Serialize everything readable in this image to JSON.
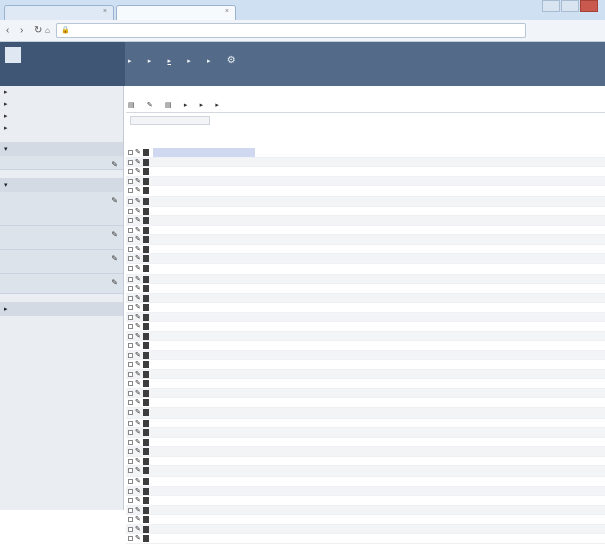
{
  "browser": {
    "tab1_label": "",
    "tab2_label": "",
    "url": ""
  },
  "logo": {
    "mark": "",
    "text_line1": "",
    "text_line2": "",
    "date": ""
  },
  "topnav": {
    "items": []
  },
  "sidebar": {
    "items": [],
    "sections": [],
    "groups": [],
    "links": []
  },
  "main": {
    "title": "",
    "toolbar": [],
    "filter_placeholder": "",
    "columns": [
      "",
      "",
      ""
    ],
    "rows": [
      {
        "c1": "",
        "c2": "",
        "c3": ""
      },
      {
        "c1": "",
        "c2": "",
        "c3": ""
      },
      {
        "c1": "",
        "c2": "",
        "c3": ""
      },
      {
        "c1": "",
        "c2": "",
        "c3": ""
      },
      {
        "c1": "",
        "c2": "",
        "c3": ""
      },
      {
        "c1": "",
        "c2": "",
        "c3": ""
      },
      {
        "c1": "",
        "c2": "",
        "c3": ""
      },
      {
        "c1": "",
        "c2": "",
        "c3": ""
      },
      {
        "c1": "",
        "c2": "",
        "c3": ""
      },
      {
        "c1": "",
        "c2": "",
        "c3": ""
      },
      {
        "c1": "",
        "c2": "",
        "c3": ""
      },
      {
        "c1": "",
        "c2": "",
        "c3": ""
      },
      {
        "c1": "",
        "c2": "",
        "c3": ""
      },
      {
        "c1": "",
        "c2": "",
        "c3": ""
      },
      {
        "c1": "",
        "c2": "",
        "c3": ""
      },
      {
        "c1": "",
        "c2": "",
        "c3": ""
      },
      {
        "c1": "",
        "c2": "",
        "c3": ""
      },
      {
        "c1": "",
        "c2": "",
        "c3": ""
      },
      {
        "c1": "",
        "c2": "",
        "c3": ""
      },
      {
        "c1": "",
        "c2": "",
        "c3": ""
      },
      {
        "c1": "",
        "c2": "",
        "c3": ""
      },
      {
        "c1": "",
        "c2": "",
        "c3": ""
      },
      {
        "c1": "",
        "c2": "",
        "c3": ""
      },
      {
        "c1": "",
        "c2": "",
        "c3": ""
      },
      {
        "c1": "",
        "c2": "",
        "c3": ""
      },
      {
        "c1": "",
        "c2": "",
        "c3": ""
      },
      {
        "c1": "",
        "c2": "",
        "c3": ""
      },
      {
        "c1": "",
        "c2": "",
        "c3": ""
      },
      {
        "c1": "",
        "c2": "",
        "c3": ""
      },
      {
        "c1": "",
        "c2": "",
        "c3": ""
      },
      {
        "c1": "",
        "c2": "",
        "c3": ""
      },
      {
        "c1": "",
        "c2": "",
        "c3": ""
      },
      {
        "c1": "",
        "c2": "",
        "c3": ""
      },
      {
        "c1": "",
        "c2": "",
        "c3": ""
      },
      {
        "c1": "",
        "c2": "",
        "c3": ""
      },
      {
        "c1": "",
        "c2": "",
        "c3": ""
      },
      {
        "c1": "",
        "c2": "",
        "c3": ""
      },
      {
        "c1": "",
        "c2": "",
        "c3": ""
      },
      {
        "c1": "",
        "c2": "",
        "c3": ""
      },
      {
        "c1": "",
        "c2": "",
        "c3": ""
      },
      {
        "c1": "",
        "c2": "",
        "c3": ""
      }
    ]
  },
  "colors": {
    "header_bg": "#536a88",
    "sidebar_bg": "#eaeef3",
    "selected_row": "#cfd8f0"
  }
}
